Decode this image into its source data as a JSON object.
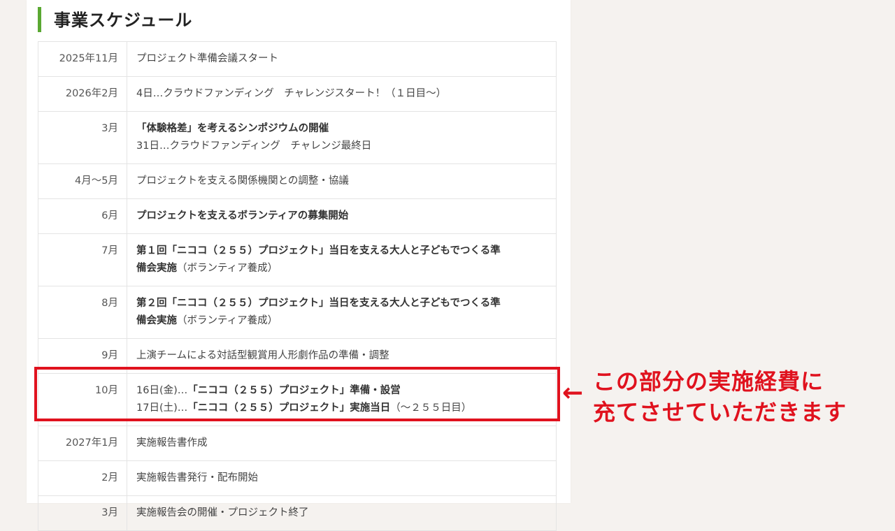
{
  "heading": "事業スケジュール",
  "rows": [
    {
      "month": "2025年11月",
      "lines": [
        {
          "parts": [
            {
              "text": "プロジェクト準備会議スタート",
              "bold": false
            }
          ]
        }
      ]
    },
    {
      "month": "2026年2月",
      "lines": [
        {
          "parts": [
            {
              "text": "4日…クラウドファンディング　チャレンジスタート！（１日目〜）",
              "bold": false
            }
          ]
        }
      ]
    },
    {
      "month": "3月",
      "lines": [
        {
          "parts": [
            {
              "text": "「体験格差」を考えるシンポジウムの開催",
              "bold": true
            }
          ]
        },
        {
          "parts": [
            {
              "text": "31日…クラウドファンディング　チャレンジ最終日",
              "bold": false
            }
          ]
        }
      ]
    },
    {
      "month": "4月〜5月",
      "lines": [
        {
          "parts": [
            {
              "text": "プロジェクトを支える関係機関との調整・協議",
              "bold": false
            }
          ]
        }
      ]
    },
    {
      "month": "6月",
      "lines": [
        {
          "parts": [
            {
              "text": "プロジェクトを支えるボランティアの募集開始",
              "bold": true
            }
          ]
        }
      ]
    },
    {
      "month": "7月",
      "lines": [
        {
          "parts": [
            {
              "text": "第１回「ニココ（２５５）プロジェクト」当日を支える大人と子どもでつくる準",
              "bold": true
            }
          ]
        },
        {
          "parts": [
            {
              "text": "備会実施",
              "bold": true
            },
            {
              "text": "（ボランティア養成）",
              "bold": false
            }
          ]
        }
      ]
    },
    {
      "month": "8月",
      "lines": [
        {
          "parts": [
            {
              "text": "第２回「ニココ（２５５）プロジェクト」当日を支える大人と子どもでつくる準",
              "bold": true
            }
          ]
        },
        {
          "parts": [
            {
              "text": "備会実施",
              "bold": true
            },
            {
              "text": "（ボランティア養成）",
              "bold": false
            }
          ]
        }
      ]
    },
    {
      "month": "9月",
      "lines": [
        {
          "parts": [
            {
              "text": "上演チームによる対話型観賞用人形劇作品の準備・調整",
              "bold": false
            }
          ]
        }
      ]
    },
    {
      "month": "10月",
      "lines": [
        {
          "parts": [
            {
              "text": "16日(金)…",
              "bold": false
            },
            {
              "text": "「ニココ（２５５）プロジェクト」準備・設営",
              "bold": true
            }
          ]
        },
        {
          "parts": [
            {
              "text": "17日(土)…",
              "bold": false
            },
            {
              "text": "「ニココ（２５５）プロジェクト」実施当日",
              "bold": true
            },
            {
              "text": "（〜２５５日目）",
              "bold": false
            }
          ]
        }
      ]
    },
    {
      "month": "2027年1月",
      "lines": [
        {
          "parts": [
            {
              "text": "実施報告書作成",
              "bold": false
            }
          ]
        }
      ]
    },
    {
      "month": "2月",
      "lines": [
        {
          "parts": [
            {
              "text": "実施報告書発行・配布開始",
              "bold": false
            }
          ]
        }
      ]
    },
    {
      "month": "3月",
      "lines": [
        {
          "parts": [
            {
              "text": "実施報告会の開催・プロジェクト終了",
              "bold": false
            }
          ]
        }
      ]
    }
  ],
  "callout": {
    "arrow": "←",
    "line1": "この部分の実施経費に",
    "line2": "充てさせていただきます"
  },
  "colors": {
    "accent_green": "#5aa832",
    "highlight_red": "#e0121e"
  }
}
